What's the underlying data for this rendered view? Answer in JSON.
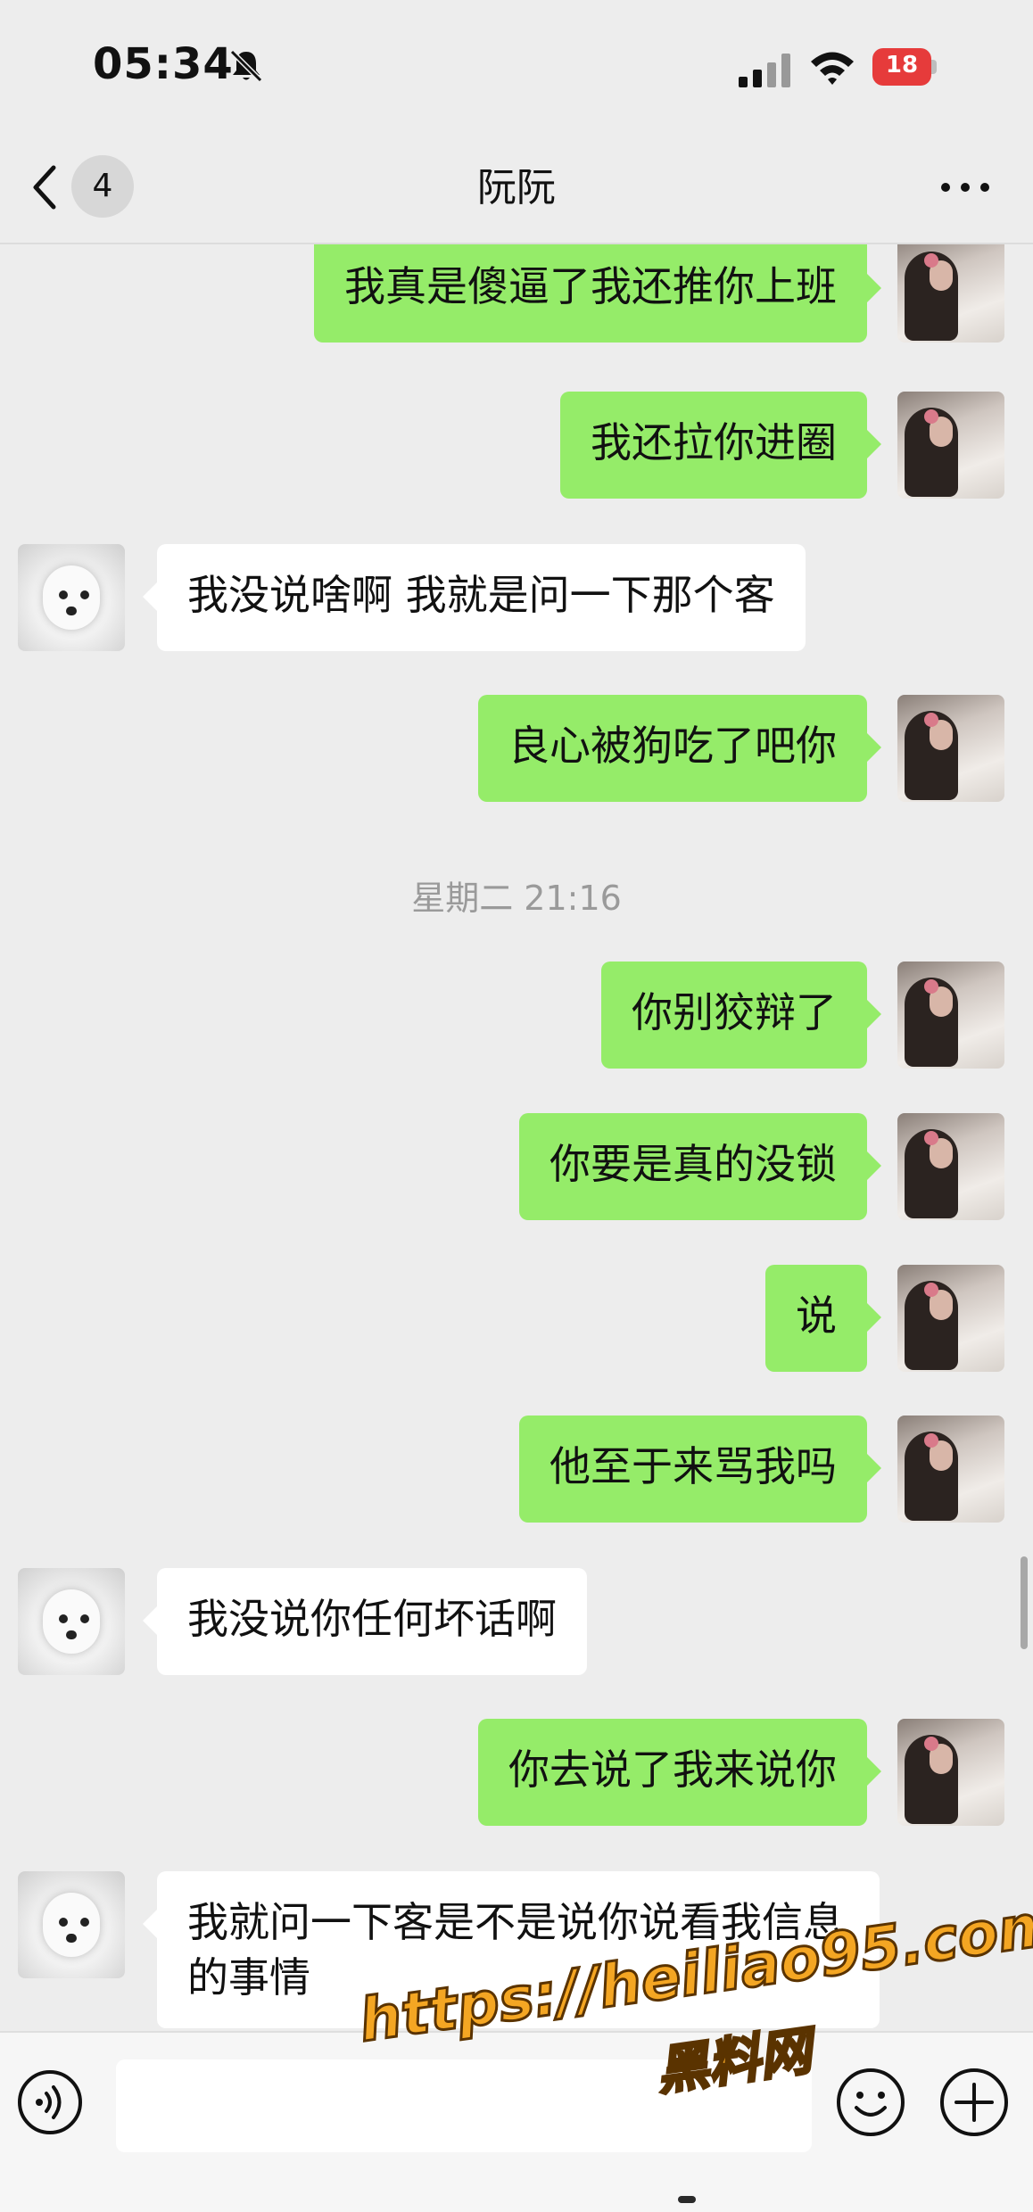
{
  "status_bar": {
    "time": "05:34",
    "battery": "18",
    "icons": [
      "bell-slash-icon",
      "cellular-signal-icon",
      "wifi-icon",
      "battery-charging-icon"
    ]
  },
  "header": {
    "back_icon": "chevron-left-icon",
    "unread_count": "4",
    "title": "阮阮",
    "more_icon": "ellipsis-icon"
  },
  "messages": [
    {
      "side": "mine",
      "text": "我真是傻逼了我还推你上班"
    },
    {
      "side": "mine",
      "text": "我还拉你进圈"
    },
    {
      "side": "other",
      "text": "我没说啥啊 我就是问一下那个客"
    },
    {
      "side": "mine",
      "text": "良心被狗吃了吧你"
    },
    {
      "type": "timestamp",
      "text": "星期二 21:16"
    },
    {
      "side": "mine",
      "text": "你别狡辩了"
    },
    {
      "side": "mine",
      "text": "你要是真的没锁"
    },
    {
      "side": "mine",
      "text": "说"
    },
    {
      "side": "mine",
      "text": "他至于来骂我吗"
    },
    {
      "side": "other",
      "text": "我没说你任何坏话啊"
    },
    {
      "side": "mine",
      "text": "你去说了我来说你"
    },
    {
      "side": "other",
      "text": "我就问一下客是不是说你说看我信息的事情"
    }
  ],
  "input_bar": {
    "voice_icon": "voice-icon",
    "input_value": "",
    "emoji_icon": "emoji-icon",
    "plus_icon": "plus-circle-icon"
  },
  "watermark": {
    "url": "https://heiliao95.com",
    "site": "黑料网"
  },
  "colors": {
    "background": "#ededed",
    "bubble_mine": "#95ec69",
    "bubble_other": "#ffffff",
    "battery_fill": "#e63b3b",
    "watermark": "#f4a623"
  }
}
